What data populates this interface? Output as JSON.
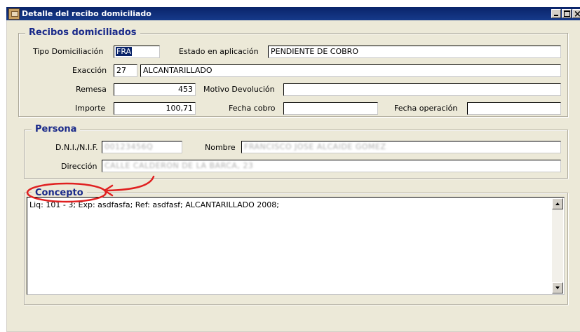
{
  "window": {
    "title": "Detalle del recibo domiciliado"
  },
  "recibos": {
    "legend": "Recibos domiciliados",
    "tipo_domiciliacion": {
      "label": "Tipo Domiciliación",
      "value": "FRA"
    },
    "estado_aplicacion": {
      "label": "Estado en aplicación",
      "value": "PENDIENTE DE COBRO"
    },
    "exaccion": {
      "label": "Exacción",
      "code": "27",
      "description": "ALCANTARILLADO"
    },
    "remesa": {
      "label": "Remesa",
      "value": "453"
    },
    "motivo_devolucion": {
      "label": "Motivo Devolución",
      "value": ""
    },
    "importe": {
      "label": "Importe",
      "value": "100,71"
    },
    "fecha_cobro": {
      "label": "Fecha cobro",
      "value": ""
    },
    "fecha_operacion": {
      "label": "Fecha operación",
      "value": ""
    }
  },
  "persona": {
    "legend": "Persona",
    "dni": {
      "label": "D.N.I./N.I.F.",
      "value": "00123456Q"
    },
    "nombre": {
      "label": "Nombre",
      "value": "FRANCISCO JOSE ALCAIDE GOMEZ"
    },
    "direccion": {
      "label": "Dirección",
      "value": "CALLE CALDERON DE LA BARCA, 23"
    }
  },
  "concepto": {
    "legend": "Concepto",
    "text": "Liq: 101 - 3; Exp: asdfasfa; Ref: asdfasf; ALCANTARILLADO 2008;"
  },
  "colors": {
    "annotation": "#e02020",
    "legend": "#1a2a8a",
    "titlebar": "#0a246a"
  }
}
